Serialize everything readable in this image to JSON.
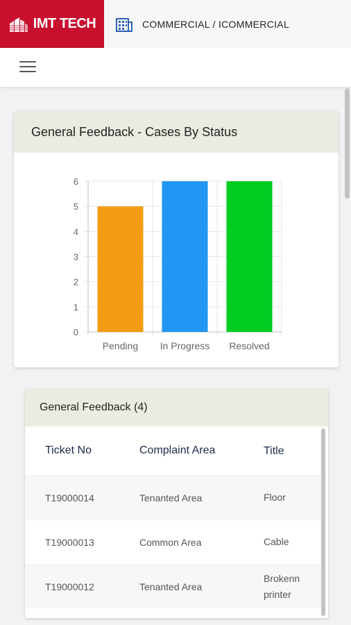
{
  "header": {
    "brand": "IMT TECH",
    "breadcrumb": "COMMERCIAL / ICOMMERCIAL",
    "brand_color": "#c8102e",
    "building_icon": "building-icon",
    "menu_icon": "hamburger-menu-icon"
  },
  "chart_card": {
    "title": "General Feedback - Cases By Status"
  },
  "chart_data": {
    "type": "bar",
    "title": "",
    "xlabel": "",
    "ylabel": "",
    "categories": [
      "Pending",
      "In Progress",
      "Resolved"
    ],
    "values": [
      5,
      6,
      6
    ],
    "colors": [
      "#f39c12",
      "#2196f3",
      "#00cc22"
    ],
    "ylim": [
      0,
      6
    ],
    "yticks": [
      0,
      1,
      2,
      3,
      4,
      5,
      6
    ],
    "grid": true
  },
  "table_card": {
    "title": "General Feedback (4)",
    "columns": [
      "Ticket No",
      "Complaint Area",
      "Title"
    ],
    "rows": [
      [
        "T19000014",
        "Tenanted Area",
        "Floor"
      ],
      [
        "T19000013",
        "Common Area",
        "Cable"
      ],
      [
        "T19000012",
        "Tenanted Area",
        "Brokenn printer"
      ]
    ]
  }
}
